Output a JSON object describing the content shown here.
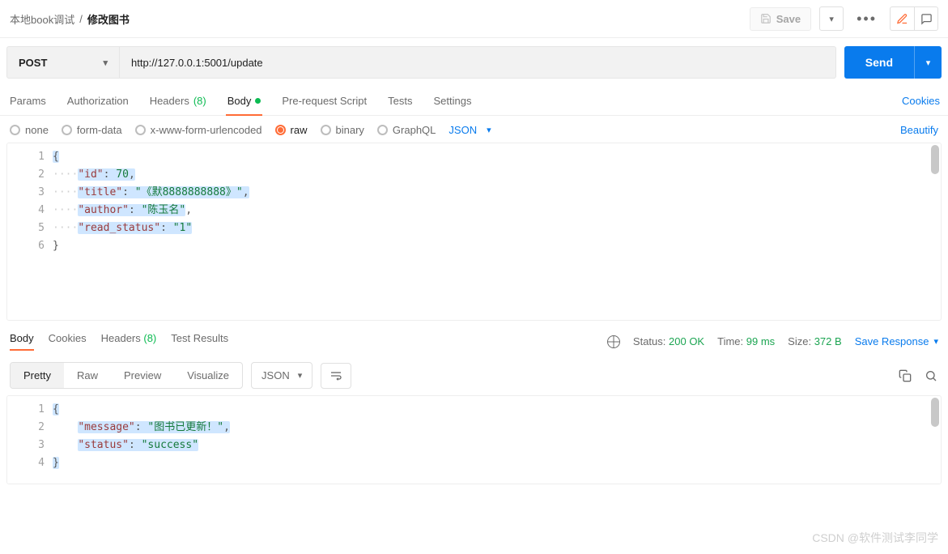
{
  "breadcrumb": {
    "parent": "本地book调试",
    "sep": "/",
    "current": "修改图书"
  },
  "top_actions": {
    "save_label": "Save"
  },
  "request": {
    "method": "POST",
    "url": "http://127.0.0.1:5001/update"
  },
  "send": {
    "label": "Send"
  },
  "tabs": {
    "params": "Params",
    "authorization": "Authorization",
    "headers": "Headers",
    "headers_count": "(8)",
    "body": "Body",
    "prerequest": "Pre-request Script",
    "tests": "Tests",
    "settings": "Settings",
    "cookies": "Cookies"
  },
  "body_sub": {
    "none": "none",
    "form_data": "form-data",
    "xwww": "x-www-form-urlencoded",
    "raw": "raw",
    "binary": "binary",
    "graphql": "GraphQL",
    "format": "JSON",
    "beautify": "Beautify"
  },
  "request_body": {
    "lines": [
      "1",
      "2",
      "3",
      "4",
      "5",
      "6"
    ],
    "open_brace": "{",
    "kv": [
      {
        "key": "\"id\"",
        "sep": ": ",
        "val": "70",
        "trail": ",",
        "is_num": true
      },
      {
        "key": "\"title\"",
        "sep": ": ",
        "val": "\"《默8888888888》\"",
        "trail": ",",
        "is_num": false
      },
      {
        "key": "\"author\"",
        "sep": ": ",
        "val": "\"陈玉名\"",
        "trail": ",",
        "is_num": false
      },
      {
        "key": "\"read_status\"",
        "sep": ": ",
        "val": "\"1\"",
        "trail": "",
        "is_num": false
      }
    ],
    "close_brace": "}"
  },
  "response_tabs": {
    "body": "Body",
    "cookies": "Cookies",
    "headers": "Headers",
    "headers_count": "(8)",
    "test_results": "Test Results"
  },
  "response_meta": {
    "status_label": "Status:",
    "status_val": "200 OK",
    "time_label": "Time:",
    "time_val": "99 ms",
    "size_label": "Size:",
    "size_val": "372 B",
    "save_response": "Save Response"
  },
  "response_view": {
    "pretty": "Pretty",
    "raw": "Raw",
    "preview": "Preview",
    "visualize": "Visualize",
    "format": "JSON"
  },
  "response_body": {
    "lines": [
      "1",
      "2",
      "3",
      "4"
    ],
    "open_brace": "{",
    "kv": [
      {
        "key": "\"message\"",
        "sep": ": ",
        "val": "\"图书已更新！\"",
        "trail": ","
      },
      {
        "key": "\"status\"",
        "sep": ": ",
        "val": "\"success\"",
        "trail": ""
      }
    ],
    "close_brace": "}"
  },
  "watermark": "CSDN @软件测试李同学"
}
